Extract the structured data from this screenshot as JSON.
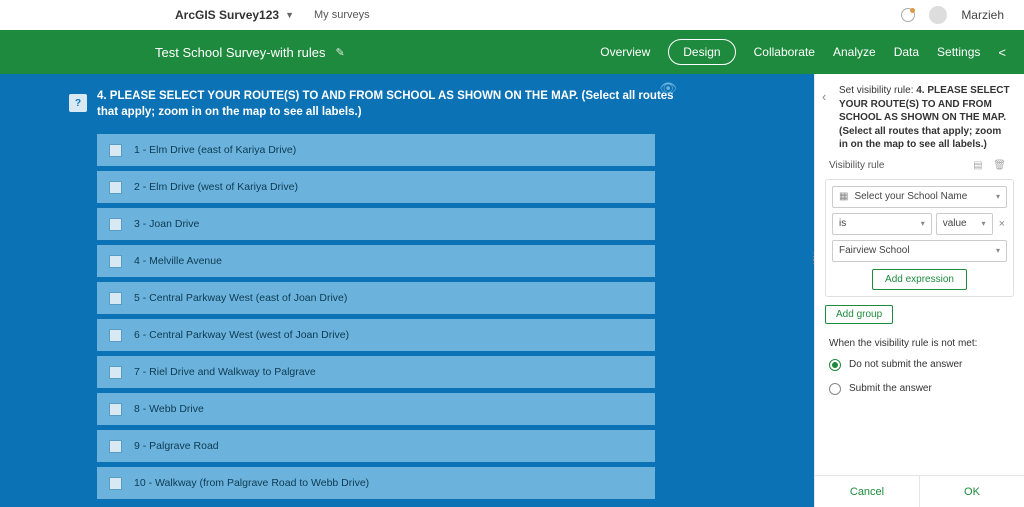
{
  "top": {
    "app_name": "ArcGIS Survey123",
    "my_surveys": "My surveys",
    "user": "Marzieh"
  },
  "green": {
    "title": "Test School Survey-with rules",
    "nav": {
      "overview": "Overview",
      "design": "Design",
      "collaborate": "Collaborate",
      "analyze": "Analyze",
      "data": "Data",
      "settings": "Settings"
    }
  },
  "question": {
    "badge": "?",
    "title": "4. PLEASE SELECT YOUR ROUTE(S) TO AND FROM SCHOOL AS SHOWN ON THE MAP. (Select all routes that apply; zoom in on the map to see all labels.)",
    "options": [
      "1 - Elm Drive (east of Kariya Drive)",
      "2 - Elm Drive (west of Kariya Drive)",
      "3 - Joan Drive",
      "4 - Melville Avenue",
      "5 - Central Parkway West (east of Joan Drive)",
      "6 - Central Parkway West (west of Joan Drive)",
      "7 - Riel Drive and Walkway to Palgrave",
      "8 - Webb Drive",
      "9 - Palgrave Road",
      "10 - Walkway (from Palgrave Road to Webb Drive)"
    ]
  },
  "panel": {
    "header_prefix": "Set visibility rule: ",
    "header_bold": "4. PLEASE SELECT YOUR ROUTE(S) TO AND FROM SCHOOL AS SHOWN ON THE MAP. (Select all routes that apply; zoom in on the map to see all labels.)",
    "rule_label": "Visibility rule",
    "field": "Select your School Name",
    "op": "is",
    "val_label": "value",
    "value": "Fairview School",
    "add_expression": "Add expression",
    "add_group": "Add group",
    "not_met": "When the visibility rule is not met:",
    "r1": "Do not submit the answer",
    "r2": "Submit the answer",
    "cancel": "Cancel",
    "ok": "OK"
  }
}
